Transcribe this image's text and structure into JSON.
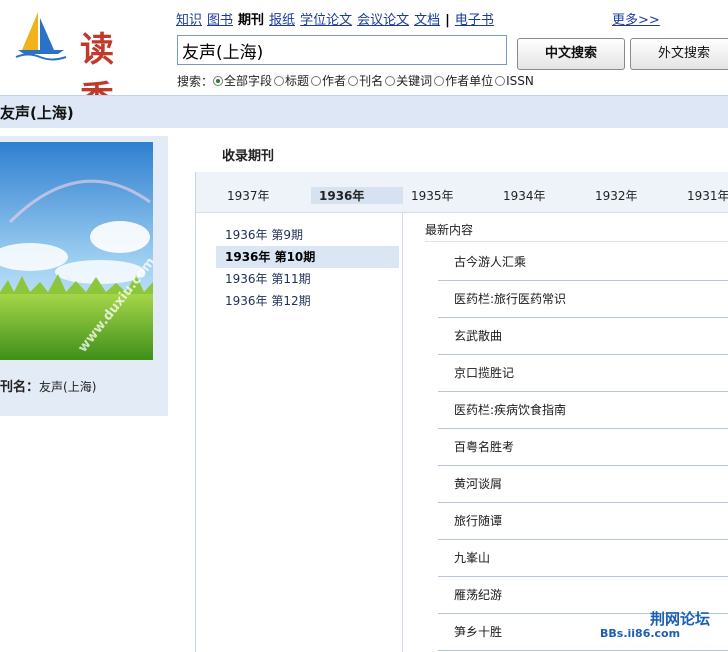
{
  "logo": {
    "text": "读秀"
  },
  "nav": {
    "items": [
      {
        "label": "知识",
        "active": false
      },
      {
        "label": "图书",
        "active": false
      },
      {
        "label": "期刊",
        "active": true
      },
      {
        "label": "报纸",
        "active": false
      },
      {
        "label": "学位论文",
        "active": false
      },
      {
        "label": "会议论文",
        "active": false
      },
      {
        "label": "文档",
        "active": false
      },
      {
        "label": "电子书",
        "active": false
      }
    ],
    "separator": "|",
    "more": "更多>>"
  },
  "search": {
    "value": "友声(上海)",
    "btn_cn": "中文搜索",
    "btn_foreign": "外文搜索",
    "filter_label": "搜索：",
    "options": [
      "全部字段",
      "标题",
      "作者",
      "刊名",
      "关键词",
      "作者单位",
      "ISSN"
    ],
    "selected": "全部字段"
  },
  "page_title": "友声(上海)",
  "left_panel": {
    "cover_watermark": "www.duxiu.com",
    "journal_label": "刊名：",
    "journal_name": "友声(上海)"
  },
  "section_heading": "收录期刊",
  "years": [
    "1937年",
    "1936年",
    "1935年",
    "1934年",
    "1932年",
    "1931年"
  ],
  "active_year": "1936年",
  "issues": [
    "1936年 第9期",
    "1936年 第10期",
    "1936年 第11期",
    "1936年 第12期"
  ],
  "active_issue": "1936年 第10期",
  "content_heading": "最新内容",
  "articles": [
    "古今游人汇乘",
    "医药栏:旅行医药常识",
    "玄武散曲",
    "京口揽胜记",
    "医药栏:疾病饮食指南",
    "百粤名胜考",
    "黄河谈屑",
    "旅行随谭",
    "九峯山",
    "雁荡纪游",
    "笋乡十胜"
  ],
  "watermark": {
    "main": "荆网论坛",
    "sub": "BBs.ii86.com"
  },
  "colors": {
    "accent": "#1a3c9c",
    "title_bar": "#dde7f5",
    "panel": "#e3ebf6"
  }
}
